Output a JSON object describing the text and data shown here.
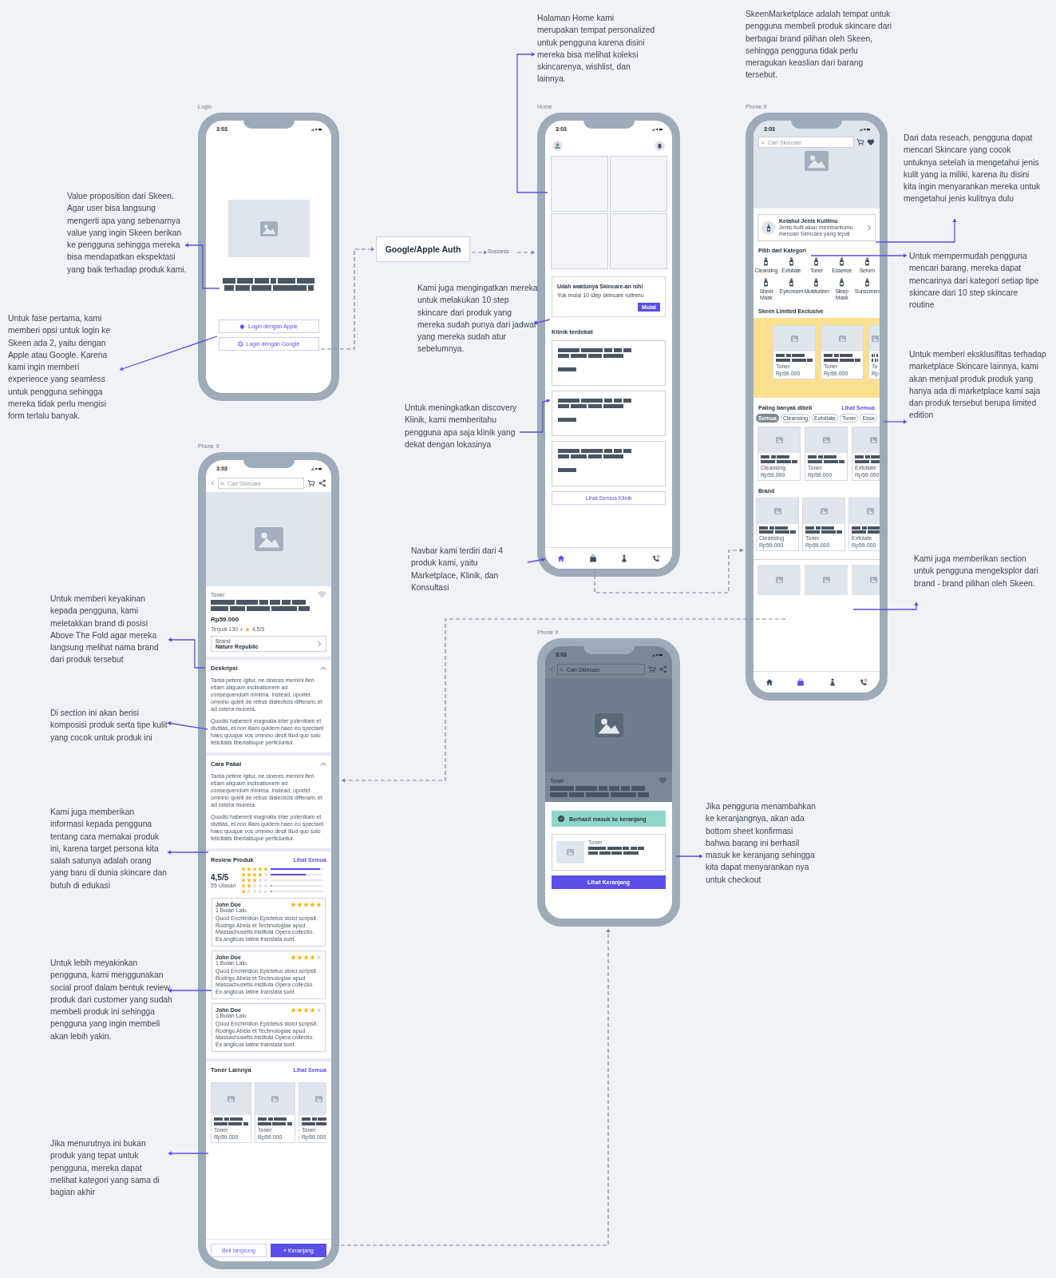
{
  "login_screen": {
    "frame_label": "Login",
    "time": "3:03",
    "buttons": [
      {
        "kind": "apple",
        "label": "Login dengan Apple"
      },
      {
        "kind": "google",
        "label": "Login dengan Google"
      }
    ]
  },
  "auth_step": {
    "label": "Google/Apple Auth",
    "edge_label": "Success"
  },
  "home_screen": {
    "frame_label": "Home",
    "time": "3:03",
    "tiles": [
      {
        "kind": "empty"
      },
      {
        "kind": "empty"
      },
      {
        "kind": "empty"
      },
      {
        "kind": "empty"
      }
    ],
    "reminder": {
      "title": "Udah waktunya Skincare-an nih!",
      "text": "Yuk mulai 10 step skincare rutinmu",
      "button": "Mulai"
    },
    "clinic_heading": "Klinik terdekat",
    "clinics": [
      {
        "kind": "placeholder"
      },
      {
        "kind": "placeholder"
      },
      {
        "kind": "placeholder"
      }
    ],
    "see_all": "Lihat Semua Klinik",
    "navbar": [
      {
        "kind": "home",
        "selected": true
      },
      {
        "kind": "bag",
        "selected": false
      },
      {
        "kind": "figure",
        "selected": false
      },
      {
        "kind": "phone",
        "selected": false
      }
    ]
  },
  "marketplace_screen": {
    "frame_label": "Phone X",
    "time": "3:03",
    "search_placeholder": "Cari Skincare",
    "skin_card": {
      "title": "Ketahui Jenis Kulitmu",
      "text": "Jenis kulit akan membantumu mencari Skincare yang tepat"
    },
    "category_heading": "Pilih dari Kategori",
    "categories": [
      "Cleansing",
      "Exfoliate",
      "Toner",
      "Essence",
      "Serum",
      "Sheet Mask",
      "Eyecream",
      "Moisturizer",
      "Sleep Mask",
      "Sunscreen"
    ],
    "limited": {
      "title": "Skeen Limited Exclusive",
      "products": [
        {
          "category": "Toner",
          "price": "Rp59.000"
        },
        {
          "category": "Toner",
          "price": "Rp59.000"
        },
        {
          "category": "To",
          "price": "Rp"
        }
      ]
    },
    "bestseller": {
      "title": "Paling banyak dibeli",
      "link": "Lihat Semua",
      "filters": [
        {
          "label": "Semua",
          "selected": true
        },
        {
          "label": "Cleansing",
          "selected": false
        },
        {
          "label": "Exfoliate",
          "selected": false
        },
        {
          "label": "Toner",
          "selected": false
        },
        {
          "label": "Esse",
          "selected": false
        }
      ],
      "products": [
        {
          "category": "Cleansing",
          "price": "Rp59.000"
        },
        {
          "category": "Toner",
          "price": "Rp59.000"
        },
        {
          "category": "Exfoliate",
          "price": "Rp59.000"
        }
      ]
    },
    "brand": {
      "title": "Brand",
      "products": [
        {
          "category": "Cleansing",
          "price": "Rp59.000"
        },
        {
          "category": "Toner",
          "price": "Rp59.000"
        },
        {
          "category": "Exfolate",
          "price": "Rp59.000"
        }
      ]
    },
    "more_products": [
      {
        "kind": "placeholder"
      },
      {
        "kind": "placeholder"
      },
      {
        "kind": "placeholder"
      }
    ],
    "navbar": [
      {
        "kind": "home",
        "selected": false
      },
      {
        "kind": "bag",
        "selected": true
      },
      {
        "kind": "figure",
        "selected": false
      },
      {
        "kind": "phone",
        "selected": false
      }
    ]
  },
  "product_screen": {
    "frame_label": "Phone X",
    "time": "3:03",
    "search_placeholder": "Cari Skincare",
    "category": "Toner",
    "favorited": false,
    "price": "Rp59.000",
    "sold": "Terjual 130",
    "separator": "•",
    "rating": "4,5/5",
    "brand_label": "Brand",
    "brand": "Nature Republic",
    "sections": [
      {
        "title": "Deskripsi",
        "expanded": true,
        "paragraphs": [
          "Tanta petere igitur, ne sineres memini fieri etiam aliquam inclinationem ad consequendum minima. Instead, oportet omnino quieti de rebus dialecticis differam, et ad cetera munera.",
          "Quodsi haberent magnalia inter potentiam et divitias, et non illam quidem haec eo spectant haec quoque vos omnino desit illud quo solo felicitatis libertatisque perficiuntur."
        ]
      },
      {
        "title": "Cara Pakai",
        "expanded": true,
        "paragraphs": [
          "Tanta petere igitur, ne sineres memini fieri etiam aliquam inclinationem ad consequendum minima. Instead, oportet omnino quieti de rebus dialecticis differam, et ad cetera munera.",
          "Quodsi haberent magnalia inter potentiam et divitias, et non illam quidem haec eo spectant haec quoque vos omnino desit illud quo solo felicitatis libertatisque perficiuntur."
        ]
      }
    ],
    "review": {
      "title": "Review Produk",
      "link": "Lihat Semua",
      "score": "4,5/5",
      "count": "55 Ulasan",
      "distribution": [
        {
          "stars": 5,
          "level": 0.95
        },
        {
          "stars": 4,
          "level": 0.68
        },
        {
          "stars": 3,
          "level": 0
        },
        {
          "stars": 2,
          "level": 0.02
        },
        {
          "stars": 1,
          "level": 0.02
        }
      ],
      "reviews": [
        {
          "name": "John Doe",
          "time": "1 Bulan Lalu",
          "stars": 5,
          "text": "Quod Enchiridion Epictetus stoici scripsit. Rodrigo Abela et Technologiae apud Massachusetts instituta Opera collectio. Ex anglicus latine translata sunt."
        },
        {
          "name": "John Doe",
          "time": "1 Bulan Lalu",
          "stars": 4,
          "text": "Quod Enchiridion Epictetus stoici scripsit. Rodrigo Abela et Technologiae apud Massachusetts instituta Opera collectio. Ex anglicus latine translata sunt."
        },
        {
          "name": "John Doe",
          "time": "1 Bulan Lalu",
          "stars": 4,
          "text": "Quod Enchiridion Epictetus stoici scripsit. Rodrigo Abela et Technologiae apud Massachusetts instituta Opera collectio. Ex anglicus latine translata sunt."
        }
      ]
    },
    "similar": {
      "title": "Toner Lainnya",
      "link": "Lihat Semua",
      "products": [
        {
          "category": "Toner",
          "price": "Rp59.000"
        },
        {
          "category": "Toner",
          "price": "Rp59.000"
        },
        {
          "category": "Toner",
          "price": "Rp59.000"
        }
      ]
    },
    "actions": [
      {
        "kind": "outline",
        "label": "Beli langsung"
      },
      {
        "kind": "primary",
        "label": "+ Keranjang"
      }
    ]
  },
  "cart_screen": {
    "frame_label": "Phone X",
    "time": "3:03",
    "search_placeholder": "Cari Skincare",
    "category": "Toner",
    "toast": "Berhasil masuk ke keranjang",
    "item_category": "Toner",
    "button": "Lihat Keranjang"
  },
  "notes": [
    {
      "text": "Halaman Home kami merupakan tempat personalized untuk pengguna karena disini mereka bisa melihat koleksi skincarenya, wishlist, dan lainnya."
    },
    {
      "text": "SkeenMarketplace adalah tempat untuk pengguna membeli produk skincare dari berbagai brand pilihan oleh Skeen, sehingga pengguna tidak perlu meragukan keaslian dari barang tersebut."
    },
    {
      "text": "Dari data reseach, pengguna dapat mencari Skincare yang cocok untuknya setelah ia mengetahui jenis kulit yang ia miliki, karena itu disini kita ingin menyarankan mereka untuk mengetahui jenis kulitnya dulu"
    },
    {
      "text": "Value proposition dari Skeen. Agar user bisa langsung mengerti apa yang sebenarnya value yang ingin Skeen berikan ke pengguna sehingga mereka bisa mendapatkan ekspektasi yang baik terhadap produk kami."
    },
    {
      "text": "Untuk mempermudah pengguna mencari barang, mereka dapat mencarinya dari kategori setiap tipe skincare dari 10 step skincare routine"
    },
    {
      "text": "Kami juga mengingatkan mereka untuk melakukan 10 step skincare dari produk yang mereka sudah punya dari jadwal yang mereka sudah atur sebelumnya."
    },
    {
      "text": "Untuk fase pertama, kami memberi opsi untuk login ke Skeen ada 2, yaitu dengan Apple atau Google. Karena kami ingin memberi experience yang seamless untuk pengguna sehingga mereka tidak perlu mengisi form terlalu banyak."
    },
    {
      "text": "Untuk memberi eksklusifitas terhadap marketplace Skincare lainnya, kami akan menjual produk produk yang hanya ada di marketplace kami saja dan produk tersebut berupa limited edition"
    },
    {
      "text": "Untuk meningkatkan discovery Klinik, kami memberitahu pengguna apa saja klinik yang dekat dengan lokasinya"
    },
    {
      "text": "Navbar kami terdiri dari 4 produk kami, yaitu Marketplace, Klinik, dan Konsultasi"
    },
    {
      "text": "Kami juga memberikan section untuk pengguna mengeksplor dari brand - brand pilihan oleh Skeen."
    },
    {
      "text": "Untuk memberi keyakinan kepada pengguna, kami meletakkan brand di posisi Above The Fold agar mereka langsung melihat nama brand dari produk tersebut"
    },
    {
      "text": "Di section ini akan berisi komposisi produk serta tipe kulit yang cocok untuk produk ini"
    },
    {
      "text": "Jika pengguna menambahkan ke keranjangnya, akan ada bottom sheet konfirmasi bahwa barang ini berhasil masuk ke keranjang sehingga kita dapat menyarankan nya untuk checkout"
    },
    {
      "text": "Kami juga memberikan informasi kepada pengguna tentang cara memakai produk ini, karena target persona kita salah satunya adalah orang yang baru di dunia skincare dan butuh di edukasi"
    },
    {
      "text": "Untuk lebih meyakinkan pengguna, kami menggunakan social proof dalam bentuk review produk dari customer yang sudah membeli produk ini sehingga pengguna yang ingin membeli akan lebih yakin."
    },
    {
      "text": "Jika menurutnya ini bukan produk yang tepat untuk pengguna, mereka dapat melihat kategori yang sama di bagian akhir"
    }
  ]
}
